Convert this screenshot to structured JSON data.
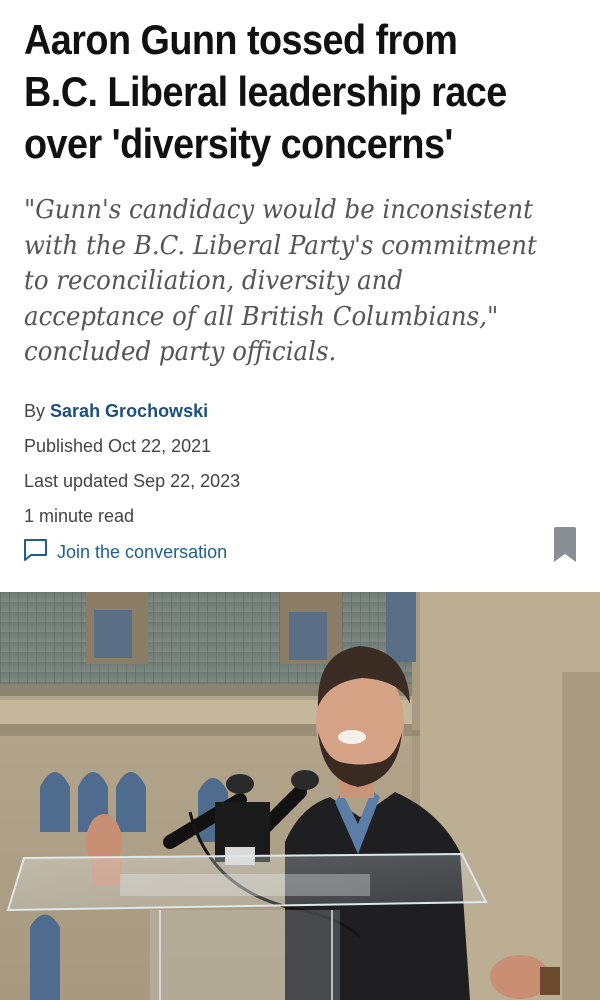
{
  "article": {
    "headline": "Aaron Gunn tossed from B.C. Liberal leadership race over 'diversity concerns'",
    "deck": "\"Gunn's candidacy would be inconsistent with the B.C. Liberal Party's commitment to reconciliation, diversity and acceptance of all British Columbians,\" concluded party officials.",
    "byline_prefix": "By",
    "author": "Sarah Grochowski",
    "published": "Published Oct 22, 2021",
    "last_updated": "Last updated Sep 22, 2023",
    "read_time": "1 minute read",
    "comments_label": "Join the conversation"
  },
  "icons": {
    "comments": "speech-bubble-icon",
    "bookmark": "bookmark-icon"
  },
  "colors": {
    "author_link": "#1a5080",
    "comments_link": "#1f5f8b",
    "bookmark": "#8a8f94"
  }
}
